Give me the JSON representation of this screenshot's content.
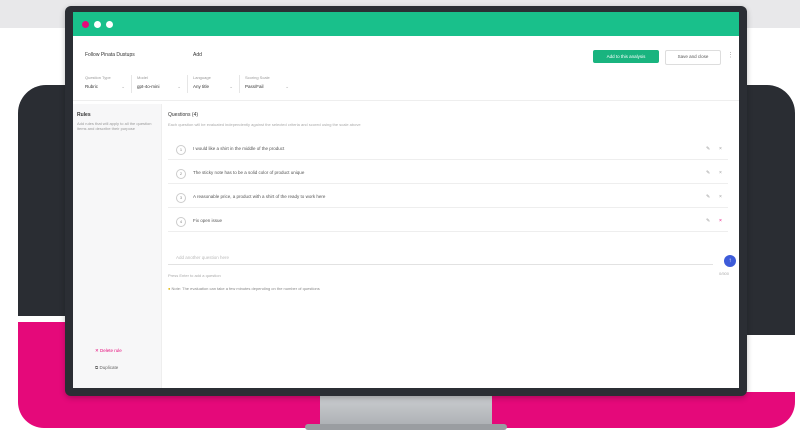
{
  "window": {
    "dot_colors": [
      "#e5097a",
      "#ffffff",
      "#ffffff"
    ]
  },
  "header": {
    "title": "Follow Pinata Dustups",
    "subtitle": "Add",
    "primary_button": "Add to this analysis",
    "secondary_button": "Save and close",
    "more_icon": "more-vertical-icon"
  },
  "filters": [
    {
      "label": "Question Type",
      "value": "Rubric"
    },
    {
      "label": "Model",
      "value": "gpt-4o-mini"
    },
    {
      "label": "Language",
      "value": "Any title"
    },
    {
      "label": "Scoring Scale",
      "value": "Pass/Fail"
    }
  ],
  "sidebar": {
    "heading": "Rules",
    "description": "Add rules that will apply to all the question items and describe their purpose",
    "delete_label": "Delete rule",
    "duplicate_label": "Duplicate"
  },
  "main": {
    "section_title": "Questions (4)",
    "section_desc": "Each question will be evaluated independently against the selected criteria and scored using the scale above",
    "rows": [
      {
        "num": "1",
        "text": "I would like a shirt in the middle of the product"
      },
      {
        "num": "2",
        "text": "The sticky note has to be a solid color of product unique"
      },
      {
        "num": "3",
        "text": "A reasonable price, a product with a shirt of the ready to work here"
      },
      {
        "num": "4",
        "text": "Fix open issue"
      }
    ],
    "input_placeholder": "Add another question here",
    "hint": "Press Enter to add a question",
    "note": "Note: The evaluation can take a few minutes depending on the number of questions",
    "counter": "0/500"
  },
  "colors": {
    "accent": "#19c08b",
    "brand_pink": "#e5097a",
    "send_blue": "#3d5bd9",
    "dark": "#2a2d33"
  }
}
